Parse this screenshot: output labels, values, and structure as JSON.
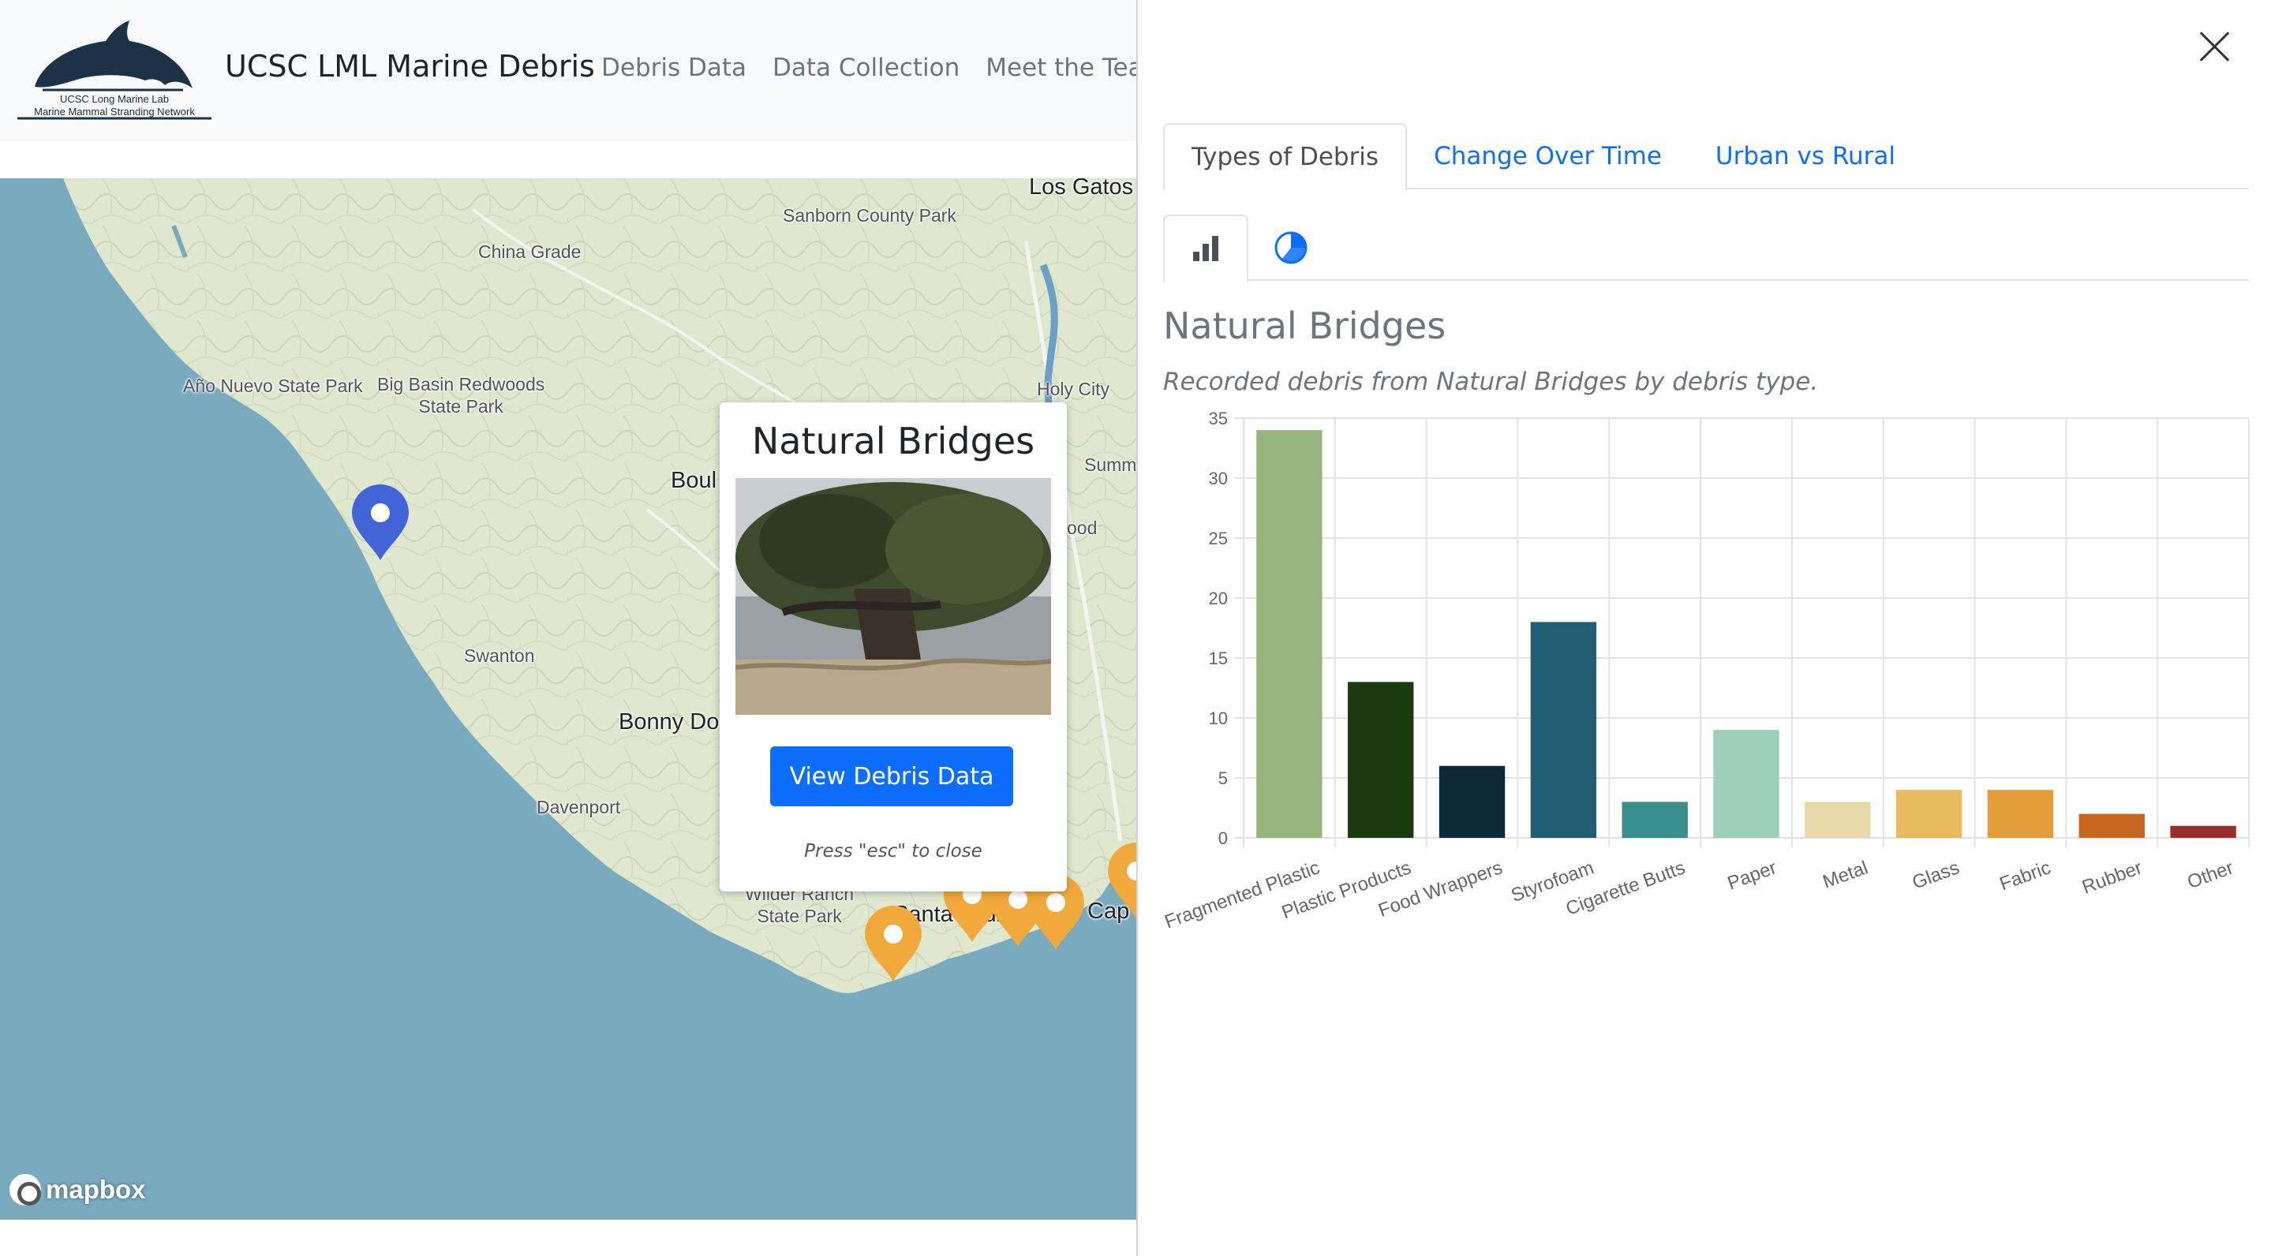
{
  "header": {
    "logo_line1": "UCSC Long Marine Lab",
    "logo_line2": "Marine Mammal Stranding Network",
    "brand": "UCSC LML Marine Debris",
    "nav": [
      "Debris Data",
      "Data Collection",
      "Meet the Team"
    ]
  },
  "map": {
    "places": {
      "los_gatos": "Los Gatos",
      "sanborn": "Sanborn County Park",
      "china_grade": "China Grade",
      "ano_nuevo": "Año Nuevo State Park",
      "big_basin_1": "Big Basin Redwoods",
      "big_basin_2": "State Park",
      "holy_city": "Holy City",
      "boulder": "Boul",
      "summit": "Summ",
      "wood": "ood",
      "swanton": "Swanton",
      "bonny_doon": "Bonny Doo",
      "davenport": "Davenport",
      "wilder_1": "Wilder Ranch",
      "wilder_2": "State Park",
      "santa_cruz": "Santa Cruz",
      "capitola": "Cap"
    },
    "attribution": "mapbox",
    "colors": {
      "ocean": "#7aaabe",
      "land": "#dfe7cf",
      "selected_marker": "#4363d8",
      "marker": "#f2a93b"
    }
  },
  "popup": {
    "title": "Natural Bridges",
    "button": "View Debris Data",
    "hint": "Press \"esc\" to close"
  },
  "panel": {
    "close_icon": "close-icon",
    "tabs": [
      "Types of Debris",
      "Change Over Time",
      "Urban vs Rural"
    ],
    "active_tab": "Types of Debris",
    "subtabs": [
      "bar-chart-icon",
      "pie-chart-icon"
    ],
    "active_subtab": "bar-chart-icon",
    "title": "Natural Bridges",
    "subtitle": "Recorded debris from Natural Bridges by debris type."
  },
  "chart_data": {
    "type": "bar",
    "categories": [
      "Fragmented Plastic",
      "Plastic Products",
      "Food Wrappers",
      "Styrofoam",
      "Cigarette Butts",
      "Paper",
      "Metal",
      "Glass",
      "Fabric",
      "Rubber",
      "Other"
    ],
    "values": [
      34,
      13,
      6,
      18,
      3,
      9,
      3,
      4,
      4,
      2,
      1
    ],
    "colors": [
      "#98b47e",
      "#1b3a12",
      "#0e2a38",
      "#235f74",
      "#3a8e8e",
      "#9ccfb8",
      "#e8d9a8",
      "#e8bb5e",
      "#e39c3a",
      "#c7651f",
      "#9b2d2a"
    ],
    "yticks": [
      0,
      5,
      10,
      15,
      20,
      25,
      30,
      35
    ],
    "ylim": [
      0,
      35
    ],
    "grid": true
  }
}
